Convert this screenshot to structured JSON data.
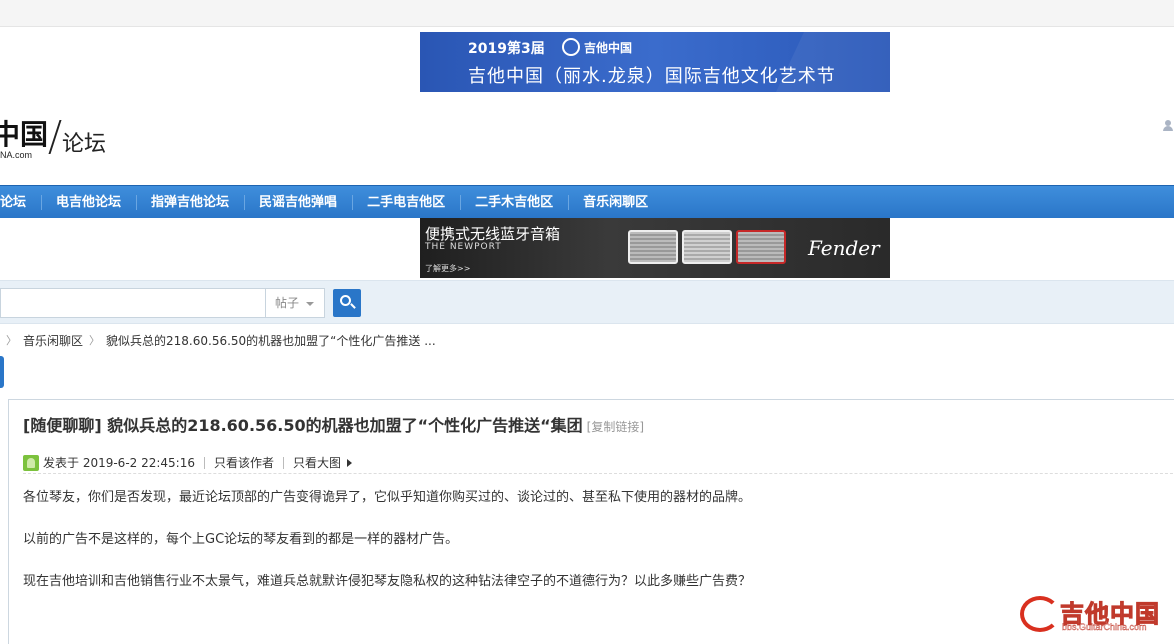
{
  "banner_top": {
    "year": "2019第3届",
    "brand": "吉他中国",
    "headline": "吉他中国（丽水.龙泉）国际吉他文化艺术节"
  },
  "logo": {
    "name": "中国",
    "sub": "NA.com",
    "forum": "论坛"
  },
  "nav": {
    "items": [
      "论坛",
      "电吉他论坛",
      "指弹吉他论坛",
      "民谣吉他弹唱",
      "二手电吉他区",
      "二手木吉他区",
      "音乐闲聊区"
    ]
  },
  "banner_mid": {
    "title": "便携式无线蓝牙音箱",
    "model": "THE NEWPORT",
    "more": "了解更多>>",
    "brand": "Fender"
  },
  "search": {
    "placeholder": "",
    "type": "帖子"
  },
  "breadcrumb": {
    "items": [
      "音乐闲聊区",
      "貌似兵总的218.60.56.50的机器也加盟了“个性化广告推送 ..."
    ]
  },
  "post": {
    "title": "[随便聊聊] 貌似兵总的218.60.56.50的机器也加盟了“个性化广告推送“集团",
    "copy_link": "[复制链接]",
    "posted": "发表于 2019-6-2 22:45:16",
    "only_author": "只看该作者",
    "only_big_image": "只看大图",
    "paragraphs": [
      "各位琴友，你们是否发现，最近论坛顶部的广告变得诡异了，它似乎知道你购买过的、谈论过的、甚至私下使用的器材的品牌。",
      "以前的广告不是这样的，每个上GC论坛的琴友看到的都是一样的器材广告。",
      "现在吉他培训和吉他销售行业不太景气，难道兵总就默许侵犯琴友隐私权的这种钻法律空子的不道德行为？以此多赚些广告费？"
    ]
  },
  "watermark": {
    "text": "吉他中国",
    "url": "bbs.GuitarChina.com"
  }
}
